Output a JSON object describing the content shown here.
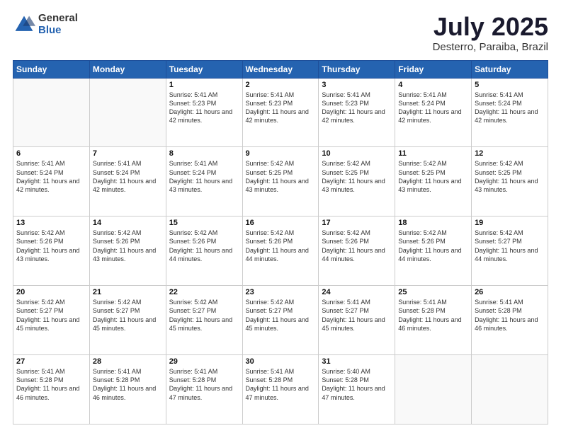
{
  "logo": {
    "general": "General",
    "blue": "Blue"
  },
  "header": {
    "month": "July 2025",
    "location": "Desterro, Paraiba, Brazil"
  },
  "weekdays": [
    "Sunday",
    "Monday",
    "Tuesday",
    "Wednesday",
    "Thursday",
    "Friday",
    "Saturday"
  ],
  "weeks": [
    [
      {
        "day": "",
        "info": ""
      },
      {
        "day": "",
        "info": ""
      },
      {
        "day": "1",
        "info": "Sunrise: 5:41 AM\nSunset: 5:23 PM\nDaylight: 11 hours and 42 minutes."
      },
      {
        "day": "2",
        "info": "Sunrise: 5:41 AM\nSunset: 5:23 PM\nDaylight: 11 hours and 42 minutes."
      },
      {
        "day": "3",
        "info": "Sunrise: 5:41 AM\nSunset: 5:23 PM\nDaylight: 11 hours and 42 minutes."
      },
      {
        "day": "4",
        "info": "Sunrise: 5:41 AM\nSunset: 5:24 PM\nDaylight: 11 hours and 42 minutes."
      },
      {
        "day": "5",
        "info": "Sunrise: 5:41 AM\nSunset: 5:24 PM\nDaylight: 11 hours and 42 minutes."
      }
    ],
    [
      {
        "day": "6",
        "info": "Sunrise: 5:41 AM\nSunset: 5:24 PM\nDaylight: 11 hours and 42 minutes."
      },
      {
        "day": "7",
        "info": "Sunrise: 5:41 AM\nSunset: 5:24 PM\nDaylight: 11 hours and 42 minutes."
      },
      {
        "day": "8",
        "info": "Sunrise: 5:41 AM\nSunset: 5:24 PM\nDaylight: 11 hours and 43 minutes."
      },
      {
        "day": "9",
        "info": "Sunrise: 5:42 AM\nSunset: 5:25 PM\nDaylight: 11 hours and 43 minutes."
      },
      {
        "day": "10",
        "info": "Sunrise: 5:42 AM\nSunset: 5:25 PM\nDaylight: 11 hours and 43 minutes."
      },
      {
        "day": "11",
        "info": "Sunrise: 5:42 AM\nSunset: 5:25 PM\nDaylight: 11 hours and 43 minutes."
      },
      {
        "day": "12",
        "info": "Sunrise: 5:42 AM\nSunset: 5:25 PM\nDaylight: 11 hours and 43 minutes."
      }
    ],
    [
      {
        "day": "13",
        "info": "Sunrise: 5:42 AM\nSunset: 5:26 PM\nDaylight: 11 hours and 43 minutes."
      },
      {
        "day": "14",
        "info": "Sunrise: 5:42 AM\nSunset: 5:26 PM\nDaylight: 11 hours and 43 minutes."
      },
      {
        "day": "15",
        "info": "Sunrise: 5:42 AM\nSunset: 5:26 PM\nDaylight: 11 hours and 44 minutes."
      },
      {
        "day": "16",
        "info": "Sunrise: 5:42 AM\nSunset: 5:26 PM\nDaylight: 11 hours and 44 minutes."
      },
      {
        "day": "17",
        "info": "Sunrise: 5:42 AM\nSunset: 5:26 PM\nDaylight: 11 hours and 44 minutes."
      },
      {
        "day": "18",
        "info": "Sunrise: 5:42 AM\nSunset: 5:26 PM\nDaylight: 11 hours and 44 minutes."
      },
      {
        "day": "19",
        "info": "Sunrise: 5:42 AM\nSunset: 5:27 PM\nDaylight: 11 hours and 44 minutes."
      }
    ],
    [
      {
        "day": "20",
        "info": "Sunrise: 5:42 AM\nSunset: 5:27 PM\nDaylight: 11 hours and 45 minutes."
      },
      {
        "day": "21",
        "info": "Sunrise: 5:42 AM\nSunset: 5:27 PM\nDaylight: 11 hours and 45 minutes."
      },
      {
        "day": "22",
        "info": "Sunrise: 5:42 AM\nSunset: 5:27 PM\nDaylight: 11 hours and 45 minutes."
      },
      {
        "day": "23",
        "info": "Sunrise: 5:42 AM\nSunset: 5:27 PM\nDaylight: 11 hours and 45 minutes."
      },
      {
        "day": "24",
        "info": "Sunrise: 5:41 AM\nSunset: 5:27 PM\nDaylight: 11 hours and 45 minutes."
      },
      {
        "day": "25",
        "info": "Sunrise: 5:41 AM\nSunset: 5:28 PM\nDaylight: 11 hours and 46 minutes."
      },
      {
        "day": "26",
        "info": "Sunrise: 5:41 AM\nSunset: 5:28 PM\nDaylight: 11 hours and 46 minutes."
      }
    ],
    [
      {
        "day": "27",
        "info": "Sunrise: 5:41 AM\nSunset: 5:28 PM\nDaylight: 11 hours and 46 minutes."
      },
      {
        "day": "28",
        "info": "Sunrise: 5:41 AM\nSunset: 5:28 PM\nDaylight: 11 hours and 46 minutes."
      },
      {
        "day": "29",
        "info": "Sunrise: 5:41 AM\nSunset: 5:28 PM\nDaylight: 11 hours and 47 minutes."
      },
      {
        "day": "30",
        "info": "Sunrise: 5:41 AM\nSunset: 5:28 PM\nDaylight: 11 hours and 47 minutes."
      },
      {
        "day": "31",
        "info": "Sunrise: 5:40 AM\nSunset: 5:28 PM\nDaylight: 11 hours and 47 minutes."
      },
      {
        "day": "",
        "info": ""
      },
      {
        "day": "",
        "info": ""
      }
    ]
  ]
}
